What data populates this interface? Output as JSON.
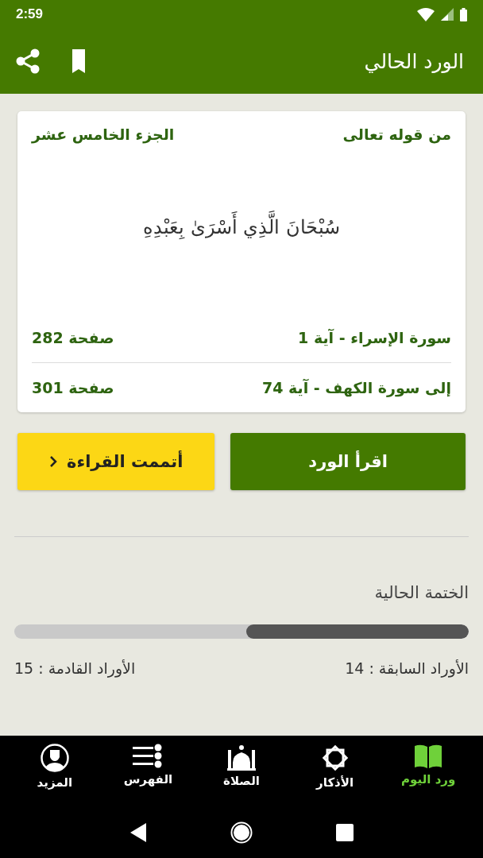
{
  "status_bar": {
    "time": "2:59"
  },
  "app_bar": {
    "title": "الورد الحالي"
  },
  "card": {
    "label_start": "من قوله تعالى",
    "juz": "الجزء الخامس عشر",
    "verse": "سُبْحَانَ الَّذِي أَسْرَىٰ بِعَبْدِهِ",
    "rows": [
      {
        "range": "سورة الإسراء - آية 1",
        "page": "صفحة 282"
      },
      {
        "range": "إلى سورة الكهف - آية 74",
        "page": "صفحة 301"
      }
    ]
  },
  "buttons": [
    {
      "kind": "primary",
      "label": "اقرأ الورد"
    },
    {
      "kind": "secondary",
      "label": "أتممت القراءة"
    }
  ],
  "khatma": {
    "title": "الختمة الحالية",
    "level": 0.49,
    "previous": "الأوراد السابقة : 14",
    "next": "الأوراد القادمة : 15"
  },
  "bottom_nav": [
    {
      "kind": "book",
      "label": "ورد اليوم",
      "selected": true
    },
    {
      "kind": "star",
      "label": "الأذكار",
      "selected": false
    },
    {
      "kind": "mosque",
      "label": "الصلاة",
      "selected": false
    },
    {
      "kind": "list",
      "label": "الفهرس",
      "selected": false
    },
    {
      "kind": "person",
      "label": "المزيد",
      "selected": false
    }
  ]
}
